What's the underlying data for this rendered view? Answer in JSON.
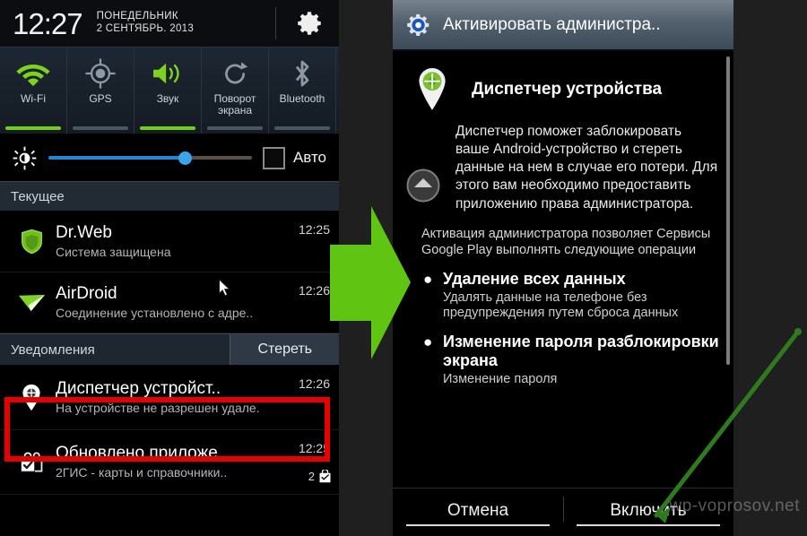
{
  "left_panel": {
    "status_bar": {
      "clock": "12:27",
      "weekday": "ПОНЕДЕЛЬНИК",
      "date": "2 СЕНТЯБРЬ. 2013",
      "settings_icon": "gear-icon"
    },
    "quick_toggles": [
      {
        "label": "Wi-Fi",
        "icon": "wifi-icon",
        "state": "on"
      },
      {
        "label": "GPS",
        "icon": "gps-icon",
        "state": "off"
      },
      {
        "label": "Звук",
        "icon": "sound-icon",
        "state": "on"
      },
      {
        "label": "Поворот\nэкрана",
        "label_l1": "Поворот",
        "label_l2": "экрана",
        "icon": "rotate-icon",
        "state": "off"
      },
      {
        "label": "Bluetooth",
        "icon": "bluetooth-icon",
        "state": "off"
      }
    ],
    "brightness": {
      "icon": "brightness-icon",
      "value_percent": 67,
      "auto_label": "Авто",
      "auto_checked": false,
      "fill_color": "#1f87d4",
      "knob_color": "#3ba3e8"
    },
    "ongoing_header": "Текущее",
    "ongoing": [
      {
        "icon": "drweb-shield-icon",
        "title": "Dr.Web",
        "subtitle": "Система защищена",
        "time": "12:25"
      },
      {
        "icon": "airdroid-icon",
        "title": "AirDroid",
        "subtitle": "Соединение установлено с адре..",
        "time": "12:26"
      }
    ],
    "notifications_header": "Уведомления",
    "clear_button": "Стереть",
    "notifications": [
      {
        "icon": "location-pin-icon",
        "title": "Диспетчер устройст..",
        "subtitle": "На устройстве не разрешен удале.",
        "time": "12:26",
        "highlighted": true
      },
      {
        "icon": "shopping-bag-check-icon",
        "title": "Обновлено приложе..",
        "subtitle": "2ГИС - карты и справочники..",
        "time": "12:25",
        "badge_count": "2",
        "badge_icon": "bag-check-icon"
      }
    ],
    "highlight_color": "#e60000"
  },
  "middle": {
    "arrow_icon": "green-right-arrow-icon",
    "arrow_color": "#5fc412"
  },
  "right_panel": {
    "title_bar": {
      "icon": "blue-gear-icon",
      "text": "Активировать администра.."
    },
    "app": {
      "icon": "green-location-pin-icon",
      "name": "Диспетчер устройства"
    },
    "collapse_icon": "up-chevron-circle-icon",
    "description": "Диспетчер поможет заблокировать ваше Android-устройство и стереть данные на нем в случае его потери. Для этого вам необходимо предоставить приложению права администратора.",
    "lead_text": "Активация администратора позволяет Сервисы Google Play выполнять следующие операции",
    "permissions": [
      {
        "title": "Удаление всех данных",
        "detail": "Удалять данные на телефоне без предупреждения путем сброса данных"
      },
      {
        "title": "Изменение пароля разблокировки экрана",
        "detail": "Изменение пароля"
      }
    ],
    "buttons": {
      "cancel": "Отмена",
      "enable": "Включить"
    }
  },
  "watermark": "wp-voprosov.net"
}
